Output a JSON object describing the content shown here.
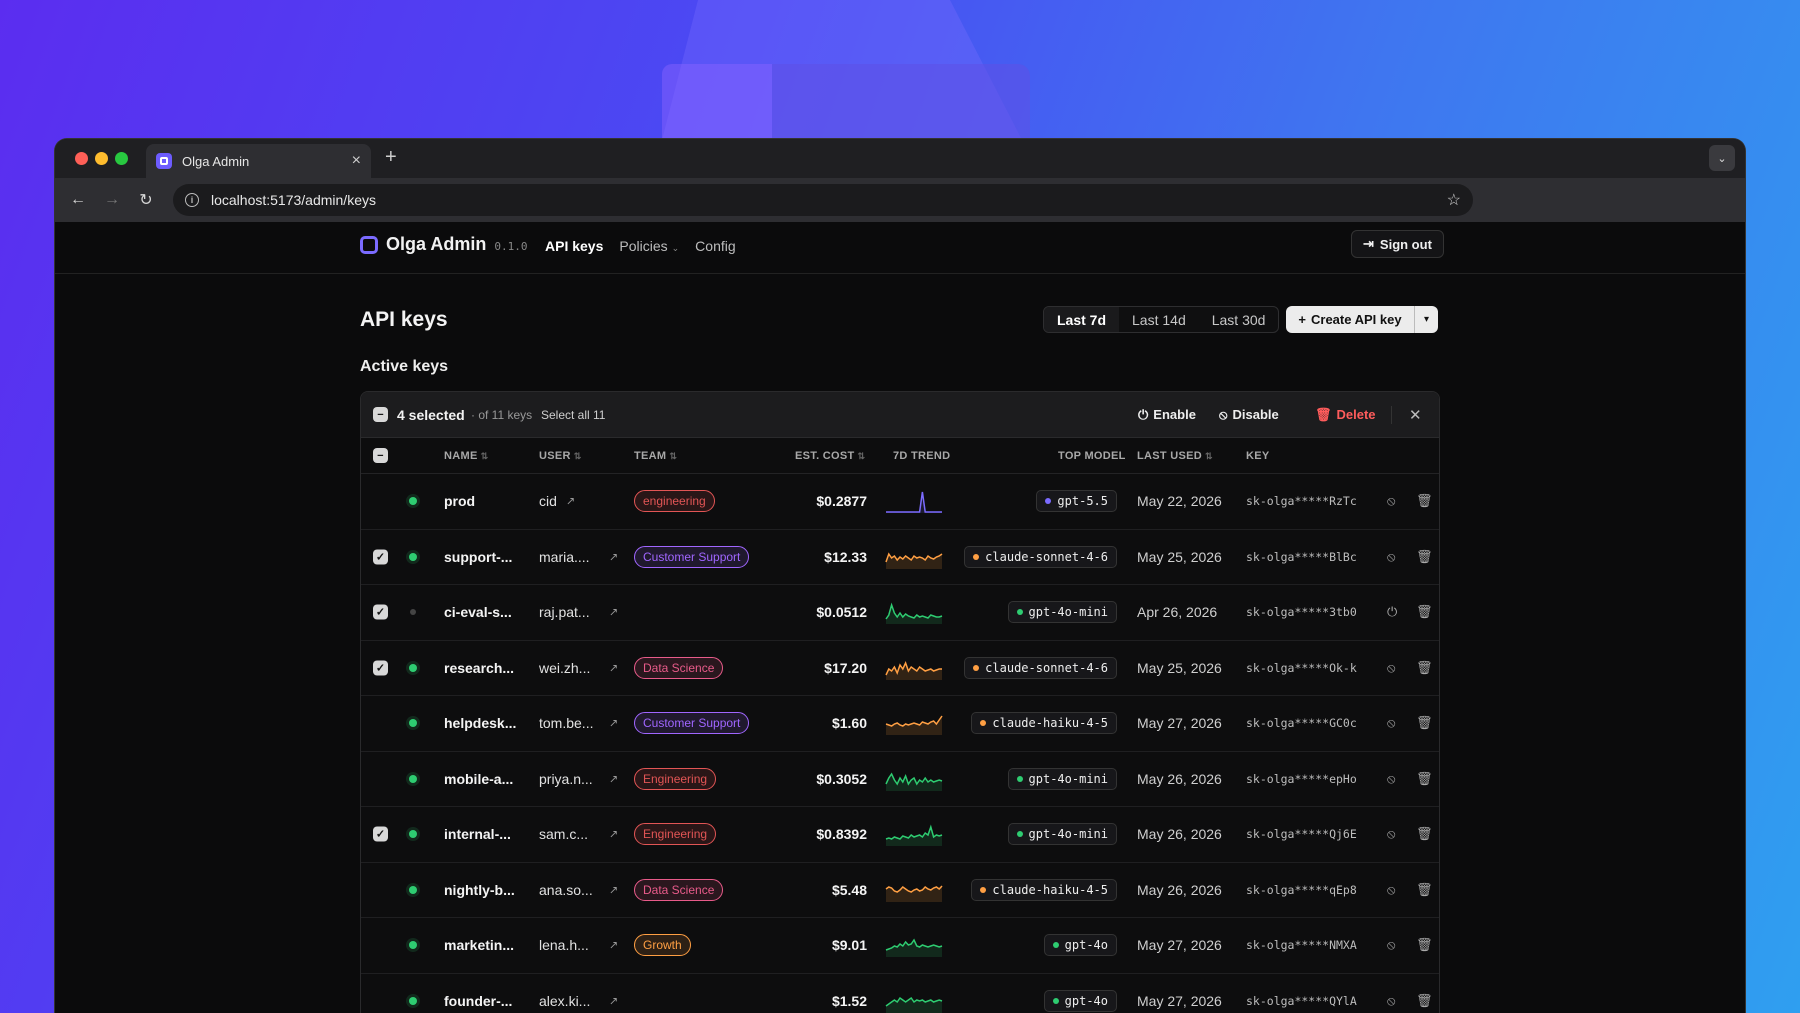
{
  "browser": {
    "tab_title": "Olga Admin",
    "url": "localhost:5173/admin/keys"
  },
  "nav": {
    "brand": "Olga Admin",
    "version": "0.1.0",
    "links": [
      "API keys",
      "Policies",
      "Config"
    ],
    "active": "API keys",
    "sign_out": "Sign out"
  },
  "page": {
    "title": "API keys",
    "ranges": [
      "Last 7d",
      "Last 14d",
      "Last 30d"
    ],
    "active_range": "Last 7d",
    "create_button": "Create API key",
    "section_title": "Active keys"
  },
  "selection": {
    "count_label": "4 selected",
    "of_label": "· of 11 keys",
    "select_all": "Select all 11",
    "enable": "Enable",
    "disable": "Disable",
    "delete": "Delete"
  },
  "columns": [
    "NAME",
    "USER",
    "TEAM",
    "EST. COST",
    "7D TREND",
    "TOP MODEL",
    "LAST USED",
    "KEY"
  ],
  "colors": {
    "accent": "#7b6bff",
    "active_status": "#2ecc71",
    "delete": "#ff5c5c"
  },
  "rows": [
    {
      "checked": false,
      "active": true,
      "name": "prod",
      "user": "cid",
      "team": "engineering",
      "team_color": "#e25555",
      "cost": "$0.2877",
      "model": "gpt-5.5",
      "model_color": "#7b6bff",
      "last_used": "May 22, 2026",
      "key": "sk-olga*****RzTc",
      "trend_color": "#7b6bff",
      "trend": [
        0,
        0,
        0,
        0,
        0,
        0,
        0,
        0,
        0,
        0,
        0,
        0,
        0,
        1,
        0,
        0,
        0,
        0,
        0,
        0,
        0
      ]
    },
    {
      "checked": true,
      "active": true,
      "name": "support-...",
      "user": "maria....",
      "team": "Customer Support",
      "team_color": "#a066ff",
      "cost": "$12.33",
      "model": "claude-sonnet-4-6",
      "model_color": "#ff9f43",
      "last_used": "May 25, 2026",
      "key": "sk-olga*****BlBc",
      "trend_color": "#ff9f43",
      "trend": [
        0.3,
        0.7,
        0.5,
        0.6,
        0.4,
        0.55,
        0.45,
        0.6,
        0.5,
        0.4,
        0.6,
        0.5,
        0.55,
        0.5,
        0.4,
        0.6,
        0.5,
        0.45,
        0.55,
        0.6,
        0.7
      ]
    },
    {
      "checked": true,
      "active": false,
      "name": "ci-eval-s...",
      "user": "raj.pat...",
      "team": "",
      "team_color": "",
      "cost": "$0.0512",
      "model": "gpt-4o-mini",
      "model_color": "#2ecc71",
      "last_used": "Apr 26, 2026",
      "key": "sk-olga*****3tb0",
      "trend_color": "#2ecc71",
      "trend": [
        0.2,
        0.4,
        0.9,
        0.5,
        0.3,
        0.5,
        0.3,
        0.45,
        0.35,
        0.3,
        0.25,
        0.4,
        0.3,
        0.35,
        0.3,
        0.25,
        0.4,
        0.35,
        0.3,
        0.3,
        0.35
      ]
    },
    {
      "checked": true,
      "active": true,
      "name": "research...",
      "user": "wei.zh...",
      "team": "Data Science",
      "team_color": "#e85b8a",
      "cost": "$17.20",
      "model": "claude-sonnet-4-6",
      "model_color": "#ff9f43",
      "last_used": "May 25, 2026",
      "key": "sk-olga*****Ok-k",
      "trend_color": "#ff9f43",
      "trend": [
        0.2,
        0.5,
        0.4,
        0.6,
        0.3,
        0.7,
        0.5,
        0.8,
        0.4,
        0.6,
        0.5,
        0.4,
        0.6,
        0.5,
        0.4,
        0.45,
        0.5,
        0.4,
        0.45,
        0.5,
        0.5
      ]
    },
    {
      "checked": false,
      "active": true,
      "name": "helpdesk...",
      "user": "tom.be...",
      "team": "Customer Support",
      "team_color": "#a066ff",
      "cost": "$1.60",
      "model": "claude-haiku-4-5",
      "model_color": "#ff9f43",
      "last_used": "May 27, 2026",
      "key": "sk-olga*****GC0c",
      "trend_color": "#ff9f43",
      "trend": [
        0.5,
        0.45,
        0.4,
        0.5,
        0.55,
        0.45,
        0.4,
        0.5,
        0.45,
        0.5,
        0.55,
        0.5,
        0.45,
        0.6,
        0.55,
        0.5,
        0.6,
        0.65,
        0.5,
        0.7,
        0.9
      ]
    },
    {
      "checked": false,
      "active": true,
      "name": "mobile-a...",
      "user": "priya.n...",
      "team": "Engineering",
      "team_color": "#e25555",
      "cost": "$0.3052",
      "model": "gpt-4o-mini",
      "model_color": "#2ecc71",
      "last_used": "May 26, 2026",
      "key": "sk-olga*****epHo",
      "trend_color": "#2ecc71",
      "trend": [
        0.3,
        0.6,
        0.8,
        0.5,
        0.3,
        0.6,
        0.4,
        0.7,
        0.3,
        0.5,
        0.6,
        0.3,
        0.5,
        0.4,
        0.6,
        0.4,
        0.5,
        0.4,
        0.45,
        0.5,
        0.45
      ]
    },
    {
      "checked": true,
      "active": true,
      "name": "internal-...",
      "user": "sam.c...",
      "team": "Engineering",
      "team_color": "#e25555",
      "cost": "$0.8392",
      "model": "gpt-4o-mini",
      "model_color": "#2ecc71",
      "last_used": "May 26, 2026",
      "key": "sk-olga*****Qj6E",
      "trend_color": "#2ecc71",
      "trend": [
        0.3,
        0.35,
        0.3,
        0.4,
        0.35,
        0.3,
        0.45,
        0.4,
        0.35,
        0.5,
        0.4,
        0.45,
        0.5,
        0.4,
        0.6,
        0.5,
        0.9,
        0.4,
        0.5,
        0.45,
        0.5
      ]
    },
    {
      "checked": false,
      "active": true,
      "name": "nightly-b...",
      "user": "ana.so...",
      "team": "Data Science",
      "team_color": "#e85b8a",
      "cost": "$5.48",
      "model": "claude-haiku-4-5",
      "model_color": "#ff9f43",
      "last_used": "May 26, 2026",
      "key": "sk-olga*****qEp8",
      "trend_color": "#ff9f43",
      "trend": [
        0.6,
        0.7,
        0.65,
        0.5,
        0.45,
        0.55,
        0.7,
        0.6,
        0.5,
        0.45,
        0.55,
        0.6,
        0.5,
        0.55,
        0.7,
        0.6,
        0.55,
        0.65,
        0.7,
        0.6,
        0.75
      ]
    },
    {
      "checked": false,
      "active": true,
      "name": "marketin...",
      "user": "lena.h...",
      "team": "Growth",
      "team_color": "#ff9f43",
      "cost": "$9.01",
      "model": "gpt-4o",
      "model_color": "#2ecc71",
      "last_used": "May 27, 2026",
      "key": "sk-olga*****NMXA",
      "trend_color": "#2ecc71",
      "trend": [
        0.3,
        0.35,
        0.4,
        0.5,
        0.45,
        0.6,
        0.5,
        0.7,
        0.55,
        0.6,
        0.8,
        0.5,
        0.45,
        0.55,
        0.5,
        0.45,
        0.5,
        0.55,
        0.5,
        0.45,
        0.5
      ]
    },
    {
      "checked": false,
      "active": true,
      "name": "founder-...",
      "user": "alex.ki...",
      "team": "",
      "team_color": "",
      "cost": "$1.52",
      "model": "gpt-4o",
      "model_color": "#2ecc71",
      "last_used": "May 27, 2026",
      "key": "sk-olga*****QYlA",
      "trend_color": "#2ecc71",
      "trend": [
        0.3,
        0.4,
        0.5,
        0.6,
        0.5,
        0.7,
        0.6,
        0.5,
        0.6,
        0.7,
        0.5,
        0.6,
        0.55,
        0.6,
        0.5,
        0.55,
        0.6,
        0.5,
        0.55,
        0.6,
        0.55
      ]
    }
  ]
}
